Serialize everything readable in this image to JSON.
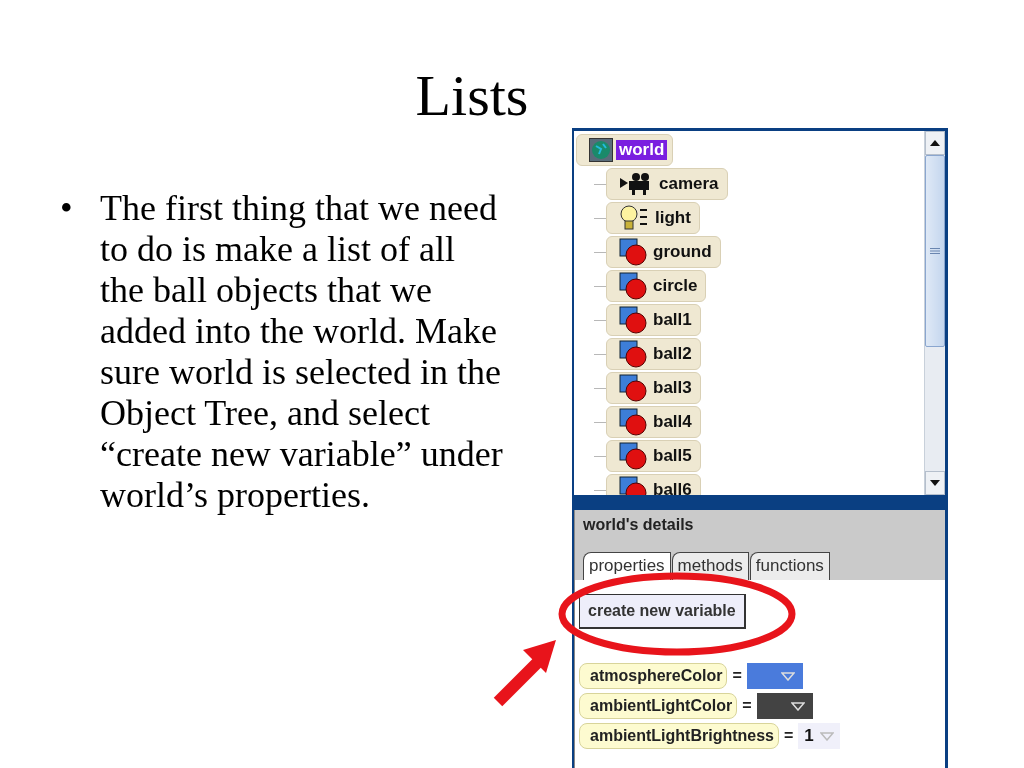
{
  "slide": {
    "title": "Lists",
    "bullet_marker": "•",
    "bullets": [
      "The first thing that we need to do is make a list of all the ball objects that we added into the world. Make sure world is selected in the Object Tree, and select “create new variable” under world’s properties."
    ]
  },
  "object_tree": {
    "root": {
      "label": "world",
      "kind": "world",
      "selected": true
    },
    "children": [
      {
        "label": "camera",
        "kind": "camera",
        "selected": false
      },
      {
        "label": "light",
        "kind": "light",
        "selected": false
      },
      {
        "label": "ground",
        "kind": "object",
        "selected": false
      },
      {
        "label": "circle",
        "kind": "object",
        "selected": false
      },
      {
        "label": "ball1",
        "kind": "object",
        "selected": false
      },
      {
        "label": "ball2",
        "kind": "object",
        "selected": false
      },
      {
        "label": "ball3",
        "kind": "object",
        "selected": false
      },
      {
        "label": "ball4",
        "kind": "object",
        "selected": false
      },
      {
        "label": "ball5",
        "kind": "object",
        "selected": false
      },
      {
        "label": "ball6",
        "kind": "object",
        "selected": false
      }
    ]
  },
  "details": {
    "title": "world's details",
    "tabs": [
      {
        "label": "properties",
        "selected": true
      },
      {
        "label": "methods",
        "selected": false
      },
      {
        "label": "functions",
        "selected": false
      }
    ],
    "button": "create new variable",
    "properties": [
      {
        "name": "atmosphereColor",
        "kind": "color",
        "color": "#4a7bdc"
      },
      {
        "name": "ambientLightColor",
        "kind": "color",
        "color": "#434343"
      },
      {
        "name": "ambientLightBrightness",
        "kind": "number",
        "value": "1"
      }
    ],
    "equals": "="
  }
}
